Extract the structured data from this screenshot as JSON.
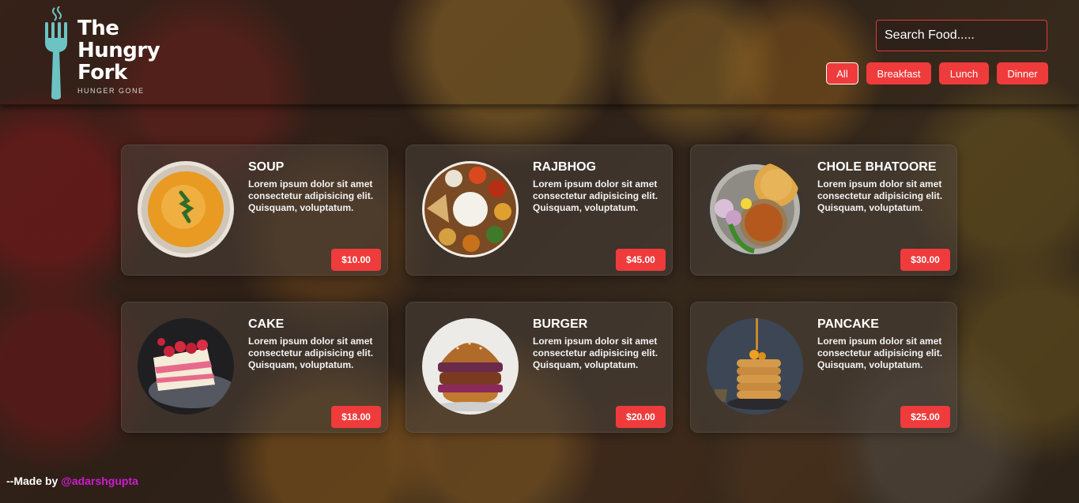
{
  "brand": {
    "name_lines": [
      "The",
      "Hungry",
      "Fork"
    ],
    "tagline": "HUNGER GONE",
    "icon": "fork-icon",
    "color": "#6cc3c4"
  },
  "search": {
    "placeholder": "Search Food....."
  },
  "filters": [
    {
      "label": "All",
      "active": true
    },
    {
      "label": "Breakfast",
      "active": false
    },
    {
      "label": "Lunch",
      "active": false
    },
    {
      "label": "Dinner",
      "active": false
    }
  ],
  "menu": [
    {
      "name": "SOUP",
      "desc": "Lorem ipsum dolor sit amet consectetur adipisicing elit. Quisquam, voluptatum.",
      "price": "$10.00",
      "image": "soup-bowl-image"
    },
    {
      "name": "RAJBHOG",
      "desc": "Lorem ipsum dolor sit amet consectetur adipisicing elit. Quisquam, voluptatum.",
      "price": "$45.00",
      "image": "thali-image"
    },
    {
      "name": "CHOLE BHATOORE",
      "desc": "Lorem ipsum dolor sit amet consectetur adipisicing elit. Quisquam, voluptatum.",
      "price": "$30.00",
      "image": "chole-bhatoore-image"
    },
    {
      "name": "CAKE",
      "desc": "Lorem ipsum dolor sit amet consectetur adipisicing elit. Quisquam, voluptatum.",
      "price": "$18.00",
      "image": "cake-slice-image"
    },
    {
      "name": "BURGER",
      "desc": "Lorem ipsum dolor sit amet consectetur adipisicing elit. Quisquam, voluptatum.",
      "price": "$20.00",
      "image": "burger-image"
    },
    {
      "name": "PANCAKE",
      "desc": "Lorem ipsum dolor sit amet consectetur adipisicing elit. Quisquam, voluptatum.",
      "price": "$25.00",
      "image": "pancake-stack-image"
    }
  ],
  "footer": {
    "prefix": "--Made by ",
    "handle": "@adarshgupta"
  },
  "colors": {
    "accent": "#ef3b3b",
    "handle": "#d21ad2"
  }
}
